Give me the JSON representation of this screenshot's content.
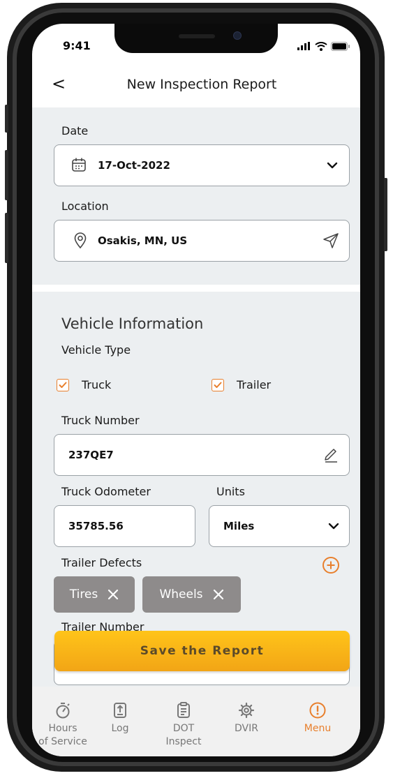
{
  "status_bar": {
    "time": "9:41"
  },
  "header": {
    "back_glyph": "<",
    "title": "New Inspection Report"
  },
  "date": {
    "label": "Date",
    "value": "17-Oct-2022",
    "icon": "calendar-icon"
  },
  "location": {
    "label": "Location",
    "value": "Osakis, MN, US",
    "icon": "location-pin-icon",
    "action_icon": "send-icon"
  },
  "vehicle": {
    "heading": "Vehicle Information",
    "type_label": "Vehicle Type",
    "types": [
      {
        "label": "Truck",
        "checked": true
      },
      {
        "label": "Trailer",
        "checked": true
      }
    ],
    "truck_number_label": "Truck Number",
    "truck_number": "237QE7",
    "odometer_label": "Truck Odometer",
    "odometer": "35785.56",
    "units_label": "Units",
    "units": "Miles",
    "trailer_defects_label": "Trailer Defects",
    "defects": [
      "Tires",
      "Wheels"
    ],
    "trailer_number_label": "Trailer Number"
  },
  "save_button": "Save the Report",
  "tabs": [
    {
      "line1": "Hours",
      "line2": "of Service",
      "icon": "stopwatch-icon",
      "active": false
    },
    {
      "line1": "Log",
      "line2": "",
      "icon": "log-upload-icon",
      "active": false
    },
    {
      "line1": "DOT",
      "line2": "Inspect",
      "icon": "clipboard-icon",
      "active": false
    },
    {
      "line1": "DVIR",
      "line2": "",
      "icon": "gear-icon",
      "active": false
    },
    {
      "line1": "Menu",
      "line2": "",
      "icon": "menu-info-icon",
      "active": true
    }
  ],
  "colors": {
    "accent": "#e87f2c",
    "chip": "#8e8b8b",
    "section_bg": "#eceff1",
    "button": "#f9b918"
  }
}
